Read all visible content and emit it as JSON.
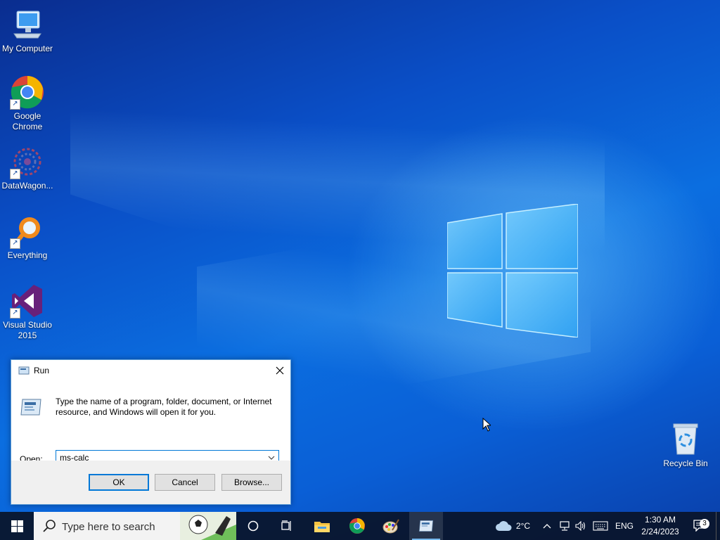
{
  "desktop": {
    "icons": [
      {
        "label": "My Computer",
        "icon": "computer-icon",
        "shortcut": false
      },
      {
        "label": "Google Chrome",
        "icon": "chrome-icon",
        "shortcut": true
      },
      {
        "label": "DataWagon...",
        "icon": "datawagon-icon",
        "shortcut": true
      },
      {
        "label": "Everything",
        "icon": "everything-search-icon",
        "shortcut": true
      },
      {
        "label": "Visual Studio 2015",
        "icon": "visual-studio-icon",
        "shortcut": true
      }
    ],
    "recycle_bin": {
      "label": "Recycle Bin",
      "icon": "recycle-bin-icon"
    }
  },
  "run_dialog": {
    "title": "Run",
    "description": "Type the name of a program, folder, document, or Internet resource, and Windows will open it for you.",
    "open_label": "Open:",
    "open_value": "ms-calc",
    "ok_label": "OK",
    "cancel_label": "Cancel",
    "browse_label": "Browse..."
  },
  "taskbar": {
    "search_placeholder": "Type here to search",
    "pinned": [
      "task-view-icon",
      "file-explorer-icon",
      "chrome-icon",
      "paint-icon",
      "run-icon"
    ],
    "weather": "2°C",
    "language": "ENG",
    "time": "1:30 AM",
    "date": "2/24/2023",
    "notification_count": "3"
  },
  "colors": {
    "accent": "#0078d7",
    "taskbar": "#0a1428",
    "desktop_blue": "#0b6ee0"
  }
}
